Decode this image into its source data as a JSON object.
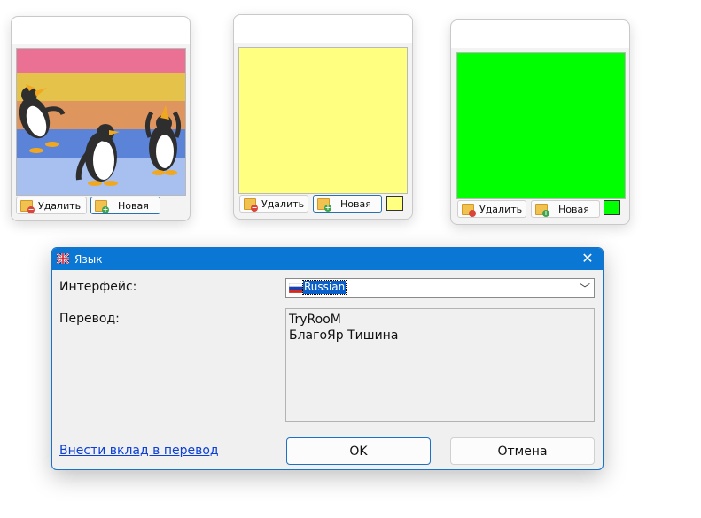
{
  "notes": [
    {
      "delete_label": "Удалить",
      "new_label": "Новая",
      "content_type": "image"
    },
    {
      "delete_label": "Удалить",
      "new_label": "Новая",
      "color": "#ffff80"
    },
    {
      "delete_label": "Удалить",
      "new_label": "Новая",
      "color": "#00ff00"
    }
  ],
  "dialog": {
    "title": "Язык",
    "interface_label": "Интерфейс:",
    "language_selected": "Russian",
    "translation_label": "Перевод:",
    "translators": [
      "TryRooM",
      "БлагоЯр Тишина"
    ],
    "contribute_link": "Внести вклад в перевод",
    "ok_label": "OK",
    "cancel_label": "Отмена"
  },
  "colors": {
    "accent": "#0a77d5",
    "note2": "#ffff80",
    "note3": "#00ff00"
  }
}
